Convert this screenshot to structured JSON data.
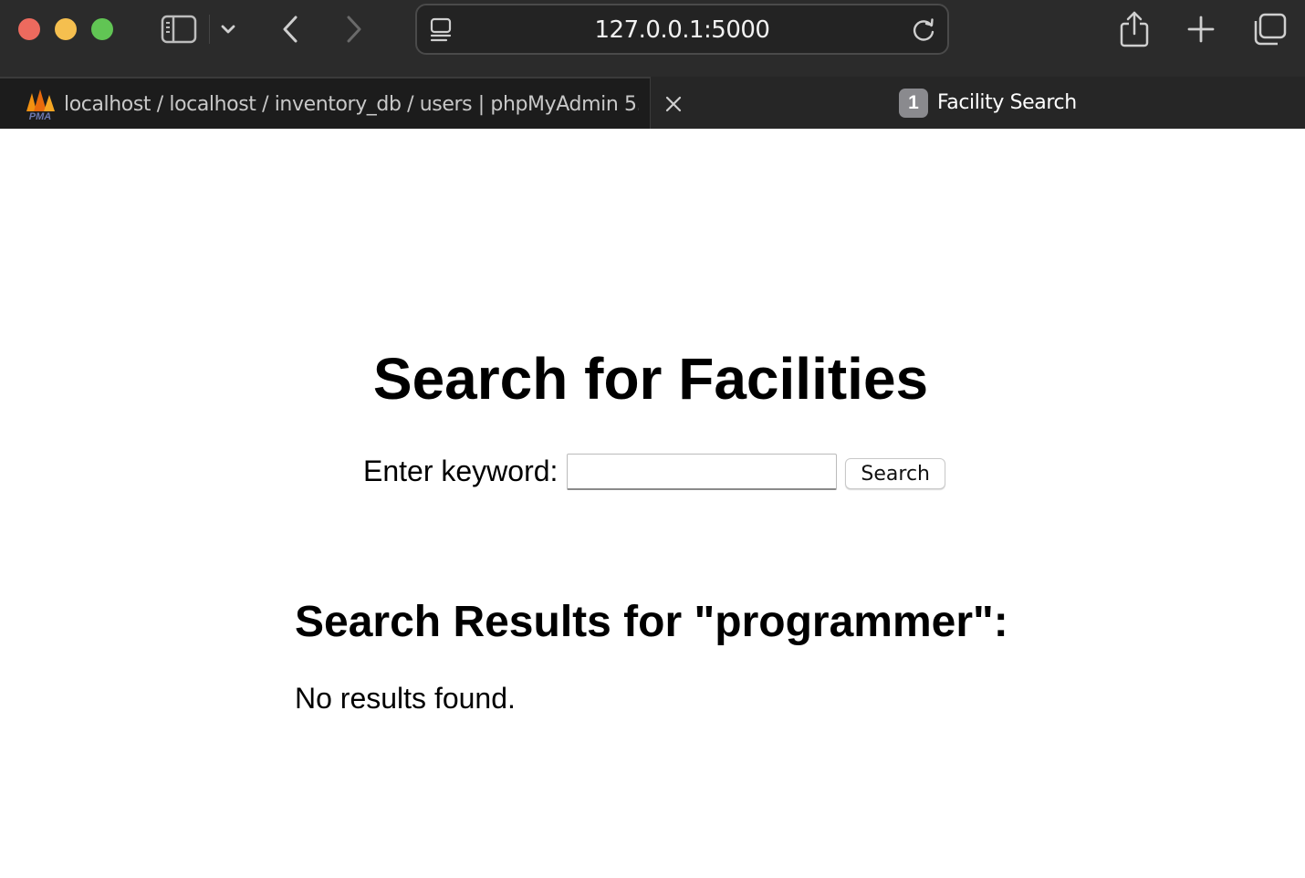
{
  "browser": {
    "address": {
      "url": "127.0.0.1:5000"
    },
    "tabs": [
      {
        "title": "localhost / localhost / inventory_db / users | phpMyAdmin 5....",
        "favicon_text": "PMA",
        "active": false
      },
      {
        "title": "Facility Search",
        "badge": "1",
        "active": true
      }
    ],
    "icons": {
      "sidebar": "sidebar-icon",
      "chevron": "chevron-down-icon",
      "back": "back-arrow-icon",
      "forward": "forward-arrow-icon",
      "site": "site-settings-icon",
      "reload": "reload-icon",
      "share": "share-icon",
      "new_tab": "plus-icon",
      "tab_overview": "tab-overview-icon",
      "close_tab": "close-icon"
    },
    "colors": {
      "close": "#ed6a5e",
      "minimize": "#f5bf4f",
      "zoom": "#61c554"
    }
  },
  "page": {
    "title": "Search for Facilities",
    "form": {
      "label": "Enter keyword:",
      "input_value": "",
      "button_label": "Search"
    },
    "results": {
      "heading": "Search Results for \"programmer\":",
      "message": "No results found."
    }
  }
}
